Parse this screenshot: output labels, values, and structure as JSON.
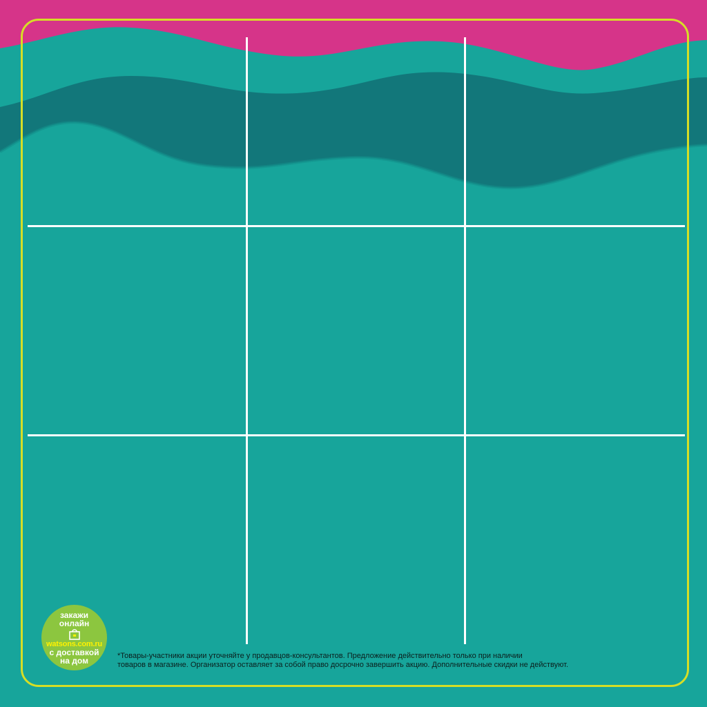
{
  "colors": {
    "background": "#17a59b",
    "wave_top": "#d63489",
    "wave_dark": "#12777a",
    "frame_border": "#d6de26",
    "grid_lines": "#ffffff",
    "badge_fill": "#8cc63f",
    "badge_url": "#fff200"
  },
  "board": {
    "rows": 3,
    "columns": 3,
    "cells_filled": 0
  },
  "badge": {
    "line1": "закажи",
    "line2": "онлайн",
    "bag_icon": "shopping-bag-icon",
    "url": "watsons.com.ru",
    "line3": "с доставкой",
    "line4": "на дом"
  },
  "disclaimer": {
    "line1": "*Товары-участники акции уточняйте у продавцов-консультантов. Предложение действительно только при наличии",
    "line2": "товаров в магазине. Организатор оставляет за собой право досрочно завершить акцию. Дополнительные скидки не действуют."
  }
}
